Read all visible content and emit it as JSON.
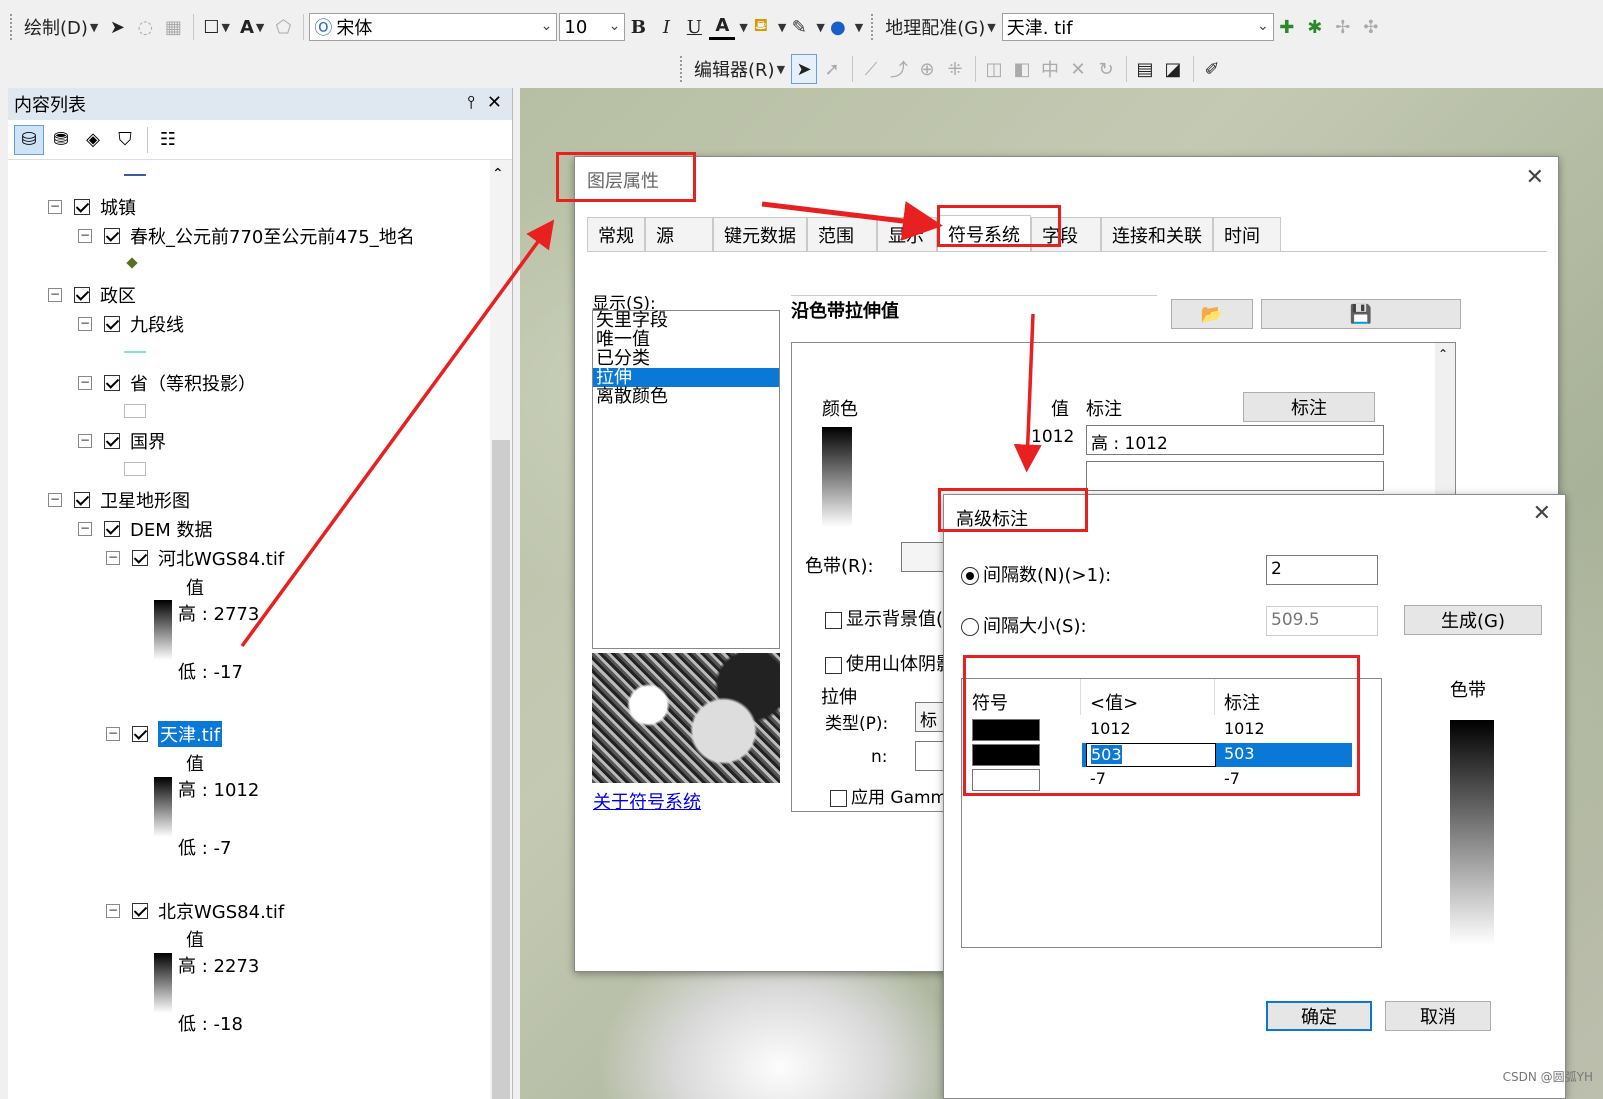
{
  "toolbar": {
    "draw_label": "绘制(D)",
    "font_name": "宋体",
    "font_size": "10",
    "bold": "B",
    "italic": "I",
    "underline": "U",
    "text_tool": "A",
    "font_color_label": "A",
    "georef_label": "地理配准(G)",
    "georef_layer": "天津. tif",
    "editor_label": "编辑器(R)"
  },
  "toc": {
    "title": "内容列表",
    "pin": "ᵖ",
    "close": "✕",
    "layers": {
      "town_group": "城镇",
      "spring_autumn": "春秋_公元前770至公元前475_地名",
      "admin_group": "政区",
      "nine_dash": "九段线",
      "province": "省（等积投影）",
      "border": "国界",
      "sat_group": "卫星地形图",
      "dem_group": "DEM 数据",
      "hebei": "河北WGS84.tif",
      "hebei_value": "值",
      "hebei_high": "高 : 2773",
      "hebei_low": "低 : -17",
      "tianjin": "天津.tif",
      "tianjin_value": "值",
      "tianjin_high": "高 : 1012",
      "tianjin_low": "低 : -7",
      "beijing": "北京WGS84.tif",
      "beijing_value": "值",
      "beijing_high": "高 : 2273",
      "beijing_low": "低 : -18"
    }
  },
  "layer_props": {
    "title": "图层属性",
    "tabs": [
      "常规",
      "源",
      "键元数据",
      "范围",
      "显示",
      "符号系统",
      "字段",
      "连接和关联",
      "时间"
    ],
    "active_tab": "符号系统",
    "show_label": "显示(S):",
    "renderers": [
      "矢里字段",
      "唯一值",
      "已分类",
      "拉伸",
      "离散颜色"
    ],
    "selected_renderer": "拉伸",
    "heading": "沿色带拉伸值",
    "color_label": "颜色",
    "value_label": "值",
    "label_label": "标注",
    "label_button": "标注",
    "value_partial": "1012",
    "label_high": "高 : 1012",
    "ramp_label": "色带(R):",
    "show_bg": "显示背景值(",
    "use_hillshade": "使用山体阴影",
    "stretch_group": "拉伸",
    "type_label": "类型(P):",
    "type_partial": "标",
    "n_label": "n:",
    "apply_gamma": "应用 Gamma",
    "about_link": "关于符号系统"
  },
  "adv_label": {
    "title": "高级标注",
    "interval_count_label": "间隔数(N)(>1):",
    "interval_count": "2",
    "interval_size_label": "间隔大小(S):",
    "interval_size": "509.5",
    "generate_btn": "生成(G)",
    "ramp_label": "色带",
    "col_symbol": "符号",
    "col_value": "<值>",
    "col_label": "标注",
    "rows": [
      {
        "value": "1012",
        "label": "1012"
      },
      {
        "value": "503",
        "label": "503"
      },
      {
        "value": "-7",
        "label": "-7"
      }
    ],
    "ok": "确定",
    "cancel": "取消"
  },
  "colors": {
    "accent_blue": "#0a78d7",
    "annotation_red": "#e8201f"
  },
  "watermark": "CSDN @圆弧YH"
}
